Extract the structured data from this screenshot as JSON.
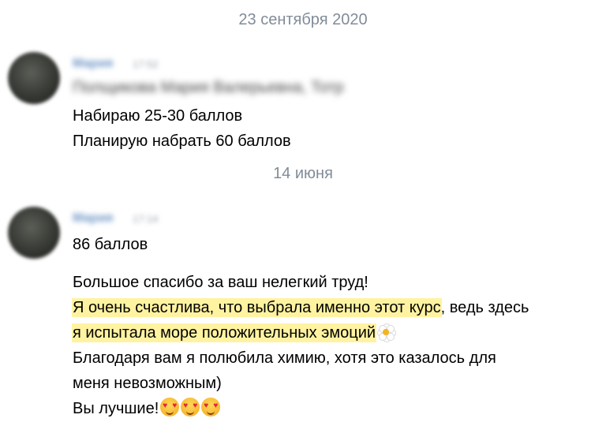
{
  "dividers": {
    "first_date": "23 сентября 2020",
    "second_date": "14 июня"
  },
  "message1": {
    "sender": "Мария",
    "time": "17:52",
    "forward_line": "Полщикова Мария Валерьевна, Тотр",
    "line1": "Набираю 25-30 баллов",
    "line2": "Планирую набрать 60 баллов"
  },
  "message2": {
    "sender": "Мария",
    "time": "17:14",
    "score_line": "86 баллов",
    "line_thanks": "Большое спасибо за ваш нелегкий труд!",
    "line_highlighted": "Я очень счастлива, что выбрала именно этот курс",
    "line_highlighted_tail": ", ведь здесь",
    "line_emotions": "я испытала море положительных эмоций",
    "line_chem1": "Благодаря вам я полюбила химию, хотя это казалось для",
    "line_chem2": "меня невозможным)",
    "line_best": "Вы лучшие!",
    "emojis": [
      "heart-eyes-emoji",
      "heart-eyes-emoji",
      "heart-eyes-emoji"
    ]
  },
  "colors": {
    "highlight": "#fff3a1",
    "date_text": "#818c99",
    "sender_name": "#6a93c4"
  }
}
